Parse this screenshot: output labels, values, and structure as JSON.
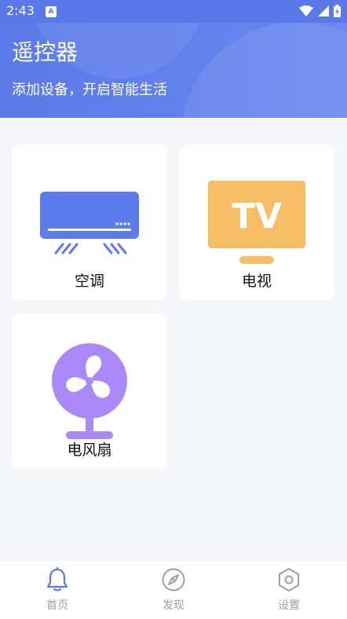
{
  "status_bar": {
    "time": "2:43",
    "notification": "A"
  },
  "header": {
    "title": "遥控器",
    "subtitle": "添加设备，开启智能生活"
  },
  "devices": [
    {
      "label": "空调",
      "icon": "air-conditioner-icon",
      "color": "#5d7cec"
    },
    {
      "label": "电视",
      "icon": "tv-icon",
      "color": "#f7be68",
      "icon_text": "TV"
    },
    {
      "label": "电风扇",
      "icon": "fan-icon",
      "color": "#aa88f8"
    }
  ],
  "bottom_nav": [
    {
      "label": "首页",
      "icon": "bell-icon",
      "active": true
    },
    {
      "label": "发现",
      "icon": "compass-icon",
      "active": false
    },
    {
      "label": "设置",
      "icon": "hexagon-settings-icon",
      "active": false
    }
  ],
  "colors": {
    "primary": "#5a78e8",
    "background": "#f6f7fb",
    "nav_inactive": "#9aa0aa"
  }
}
